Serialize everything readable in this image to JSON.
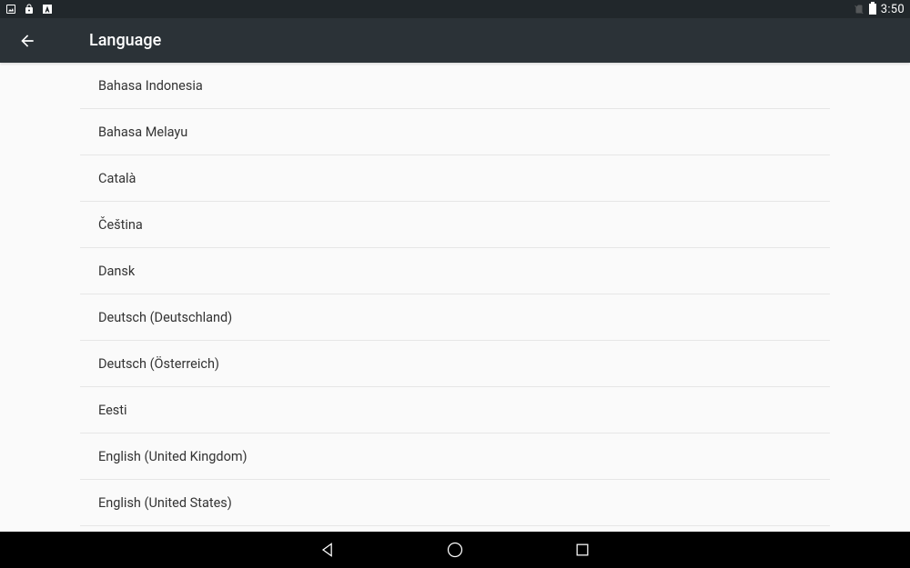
{
  "statusBar": {
    "clock": "3:50"
  },
  "appBar": {
    "title": "Language"
  },
  "languages": [
    "Bahasa Indonesia",
    "Bahasa Melayu",
    "Català",
    "Čeština",
    "Dansk",
    "Deutsch (Deutschland)",
    "Deutsch (Österreich)",
    "Eesti",
    "English (United Kingdom)",
    "English (United States)"
  ]
}
